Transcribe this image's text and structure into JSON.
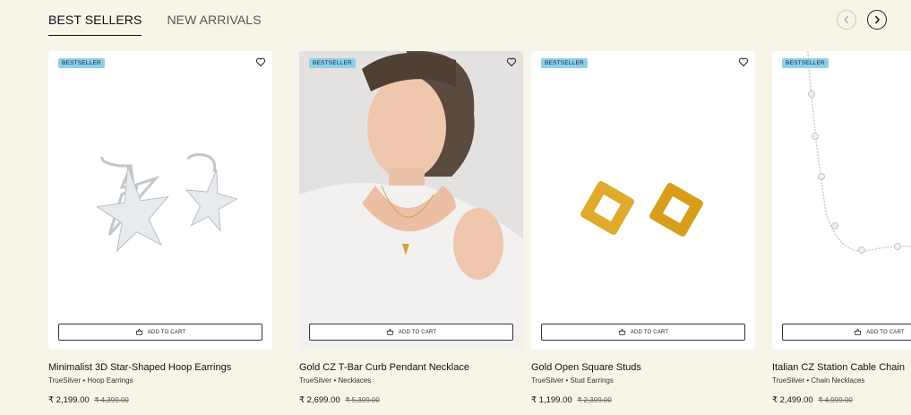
{
  "tabs": [
    {
      "label": "BEST SELLERS",
      "active": true
    },
    {
      "label": "NEW ARRIVALS",
      "active": false
    }
  ],
  "nav": {
    "prev_icon": "chevron-left-icon",
    "next_icon": "chevron-right-icon"
  },
  "add_to_cart_label": "ADD TO CART",
  "products": [
    {
      "badge": "BESTSELLER",
      "name": "Minimalist 3D Star-Shaped Hoop Earrings",
      "brand_category": "TrueSilver • Hoop Earrings",
      "price": "₹ 2,199.00",
      "mrp": "₹ 4,399.00",
      "image": "silver star hoop earrings"
    },
    {
      "badge": "BESTSELLER",
      "name": "Gold CZ T-Bar Curb Pendant Necklace",
      "brand_category": "TrueSilver • Necklaces",
      "price": "₹ 2,699.00",
      "mrp": "₹ 5,399.00",
      "image": "model wearing gold necklace"
    },
    {
      "badge": "BESTSELLER",
      "name": "Gold Open Square Studs",
      "brand_category": "TrueSilver • Stud Earrings",
      "price": "₹ 1,199.00",
      "mrp": "₹ 2,399.00",
      "image": "gold square studs"
    },
    {
      "badge": "BESTSELLER",
      "name": "Italian CZ Station Cable Chain",
      "brand_category": "TrueSilver • Chain Necklaces",
      "price": "₹ 2,499.00",
      "mrp": "₹ 4,999.00",
      "image": "silver station chain"
    }
  ],
  "colors": {
    "background": "#f7f5e8",
    "badge": "#8fd0e8",
    "gold": "#d9a21f",
    "silver": "#cfd3d6"
  }
}
